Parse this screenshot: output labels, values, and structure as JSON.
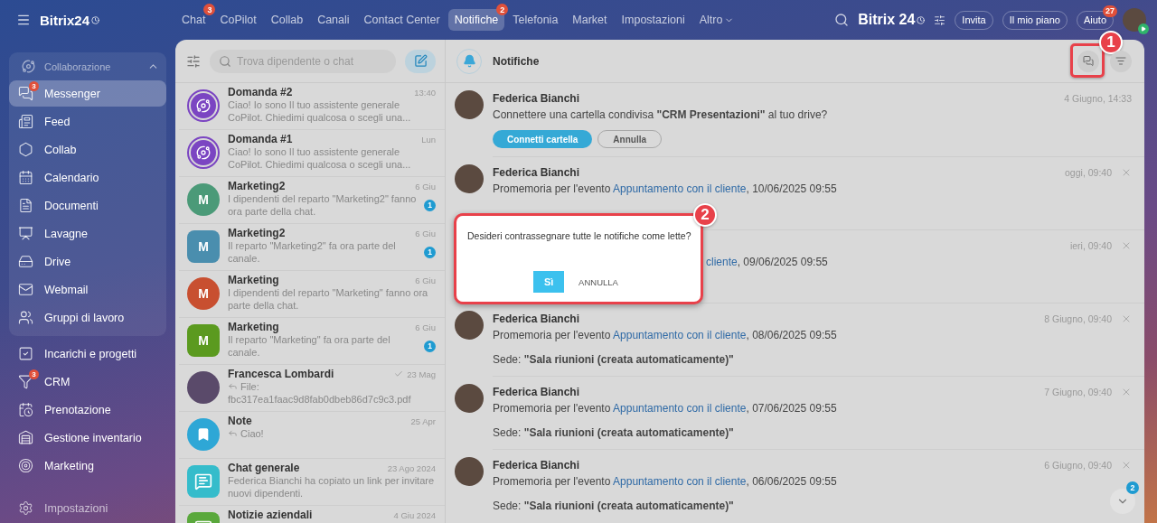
{
  "topbar": {
    "logo": "Bitrix24",
    "tabs": [
      {
        "label": "Chat",
        "badge": "3",
        "selected": false,
        "has_menu": false
      },
      {
        "label": "CoPilot",
        "selected": false,
        "has_menu": false
      },
      {
        "label": "Collab",
        "selected": false,
        "has_menu": false
      },
      {
        "label": "Canali",
        "selected": false,
        "has_menu": false
      },
      {
        "label": "Contact Center",
        "selected": false,
        "has_menu": false
      },
      {
        "label": "Notifiche",
        "badge": "2",
        "selected": true,
        "has_menu": false
      },
      {
        "label": "Telefonia",
        "selected": false,
        "has_menu": false
      },
      {
        "label": "Market",
        "selected": false,
        "has_menu": false
      },
      {
        "label": "Impostazioni",
        "selected": false,
        "has_menu": false
      },
      {
        "label": "Altro",
        "selected": false,
        "has_menu": true
      }
    ],
    "brand": "Bitrix 24",
    "buttons": [
      {
        "label": "Invita"
      },
      {
        "label": "Il mio piano"
      },
      {
        "label": "Aiuto",
        "badge": "27"
      }
    ]
  },
  "sidebar": {
    "group": {
      "label": "Collaborazione",
      "expanded": true,
      "items": [
        {
          "label": "Messenger",
          "badge": "3",
          "selected": true
        },
        {
          "label": "Feed",
          "selected": false
        },
        {
          "label": "Collab",
          "selected": false
        },
        {
          "label": "Calendario",
          "selected": false
        },
        {
          "label": "Documenti",
          "selected": false
        },
        {
          "label": "Lavagne",
          "selected": false
        },
        {
          "label": "Drive",
          "selected": false
        },
        {
          "label": "Webmail",
          "selected": false
        },
        {
          "label": "Gruppi di lavoro",
          "selected": false
        }
      ]
    },
    "items": [
      {
        "label": "Incarichi e progetti",
        "selected": false
      },
      {
        "label": "CRM",
        "badge": "3",
        "selected": false
      },
      {
        "label": "Prenotazione",
        "selected": false
      },
      {
        "label": "Gestione inventario",
        "selected": false
      },
      {
        "label": "Marketing",
        "selected": false
      }
    ],
    "settings": "Impostazioni"
  },
  "chat_list": {
    "search_placeholder": "Trova dipendente o chat",
    "chats": [
      {
        "kind": "copilot",
        "name": "Domanda #2",
        "preview": "Ciao! Io sono Il tuo assistente generale CoPilot. Chiedimi qualcosa o scegli una...",
        "time": "13:40",
        "color": "#7b45c2",
        "reply": false,
        "delivered": false
      },
      {
        "kind": "copilot",
        "name": "Domanda #1",
        "preview": "Ciao! Io sono Il tuo assistente generale CoPilot. Chiedimi qualcosa o scegli una...",
        "time": "Lun",
        "color": "#7b45c2",
        "reply": false,
        "delivered": false
      },
      {
        "kind": "chat",
        "name": "Marketing2",
        "initial": "M",
        "preview": "I dipendenti del reparto \"Marketing2\" fanno ora parte della chat.",
        "time": "6 Giu",
        "unread": "1",
        "color": "#4b9a78",
        "reply": false,
        "delivered": false
      },
      {
        "kind": "channel",
        "name": "Marketing2",
        "initial": "M",
        "preview": "Il reparto \"Marketing2\" fa ora parte del canale.",
        "time": "6 Giu",
        "unread": "1",
        "color": "#4a8eae",
        "reply": false,
        "delivered": false
      },
      {
        "kind": "chat",
        "name": "Marketing",
        "initial": "M",
        "preview": "I dipendenti del reparto \"Marketing\" fanno ora parte della chat.",
        "time": "6 Giu",
        "color": "#c84f30",
        "reply": false,
        "delivered": false
      },
      {
        "kind": "channel",
        "name": "Marketing",
        "initial": "M",
        "preview": "Il reparto \"Marketing\" fa ora parte del canale.",
        "time": "6 Giu",
        "unread": "1",
        "color": "#5b9a1f",
        "reply": false,
        "delivered": false
      },
      {
        "kind": "person",
        "name": "Francesca Lombardi",
        "preview": "File: fbc317ea1faac9d8fab0dbeb86d7c9c3.pdf",
        "time": "23 Mag",
        "color": "#5a4a6a",
        "reply": true,
        "delivered": true
      },
      {
        "kind": "notes",
        "name": "Note",
        "preview": "Ciao!",
        "time": "25 Apr",
        "color": "#2ea7d6",
        "reply": true,
        "delivered": false
      },
      {
        "kind": "group",
        "name": "Chat generale",
        "preview": "Federica Bianchi ha copiato un link per invitare nuovi dipendenti.",
        "time": "23 Ago 2024",
        "color": "#35bccb",
        "reply": false,
        "delivered": false
      },
      {
        "kind": "group",
        "name": "Notizie aziendali",
        "time": "4 Giu 2024",
        "color": "#5aa83c",
        "reply": false,
        "delivered": false
      }
    ]
  },
  "notifications": {
    "title": "Notifiche",
    "items": [
      {
        "kind": "action",
        "name": "Federica Bianchi",
        "time": "4 Giugno, 14:33",
        "text": "Connettere una cartella condivisa **\"CRM Presentazioni\"** al tuo drive?",
        "buttons": [
          "Connetti cartella",
          "Annulla"
        ],
        "closable": false
      },
      {
        "kind": "reminder",
        "name": "Federica Bianchi",
        "time": "oggi, 09:40",
        "before": "Promemoria per l'evento ",
        "link": "Appuntamento con il cliente",
        "after": ", 10/06/2025 09:55",
        "closable": true
      },
      {
        "kind": "partial",
        "time": "ieri, 09:40",
        "link": "cliente",
        "after": ", 09/06/2025 09:55",
        "closable": true
      },
      {
        "kind": "reminder",
        "name": "Federica Bianchi",
        "time": "8 Giugno, 09:40",
        "before": "Promemoria per l'evento ",
        "link": "Appuntamento con il cliente",
        "after": ", 08/06/2025 09:55",
        "location": "Sede: **\"Sala riunioni (creata automaticamente)\"**",
        "closable": true
      },
      {
        "kind": "reminder",
        "name": "Federica Bianchi",
        "time": "7 Giugno, 09:40",
        "before": "Promemoria per l'evento ",
        "link": "Appuntamento con il cliente",
        "after": ", 07/06/2025 09:55",
        "location": "Sede: **\"Sala riunioni (creata automaticamente)\"**",
        "closable": true
      },
      {
        "kind": "reminder",
        "name": "Federica Bianchi",
        "time": "6 Giugno, 09:40",
        "before": "Promemoria per l'evento ",
        "link": "Appuntamento con il cliente",
        "after": ", 06/06/2025 09:55",
        "location": "Sede: **\"Sala riunioni (creata automaticamente)\"**",
        "closable": true
      }
    ],
    "scroll_badge": "2"
  },
  "dialog": {
    "message": "Desideri contrassegnare tutte le notifiche come lette?",
    "confirm": "Sì",
    "cancel": "ANNULLA"
  },
  "markers": [
    {
      "label": "1"
    },
    {
      "label": "2"
    }
  ]
}
